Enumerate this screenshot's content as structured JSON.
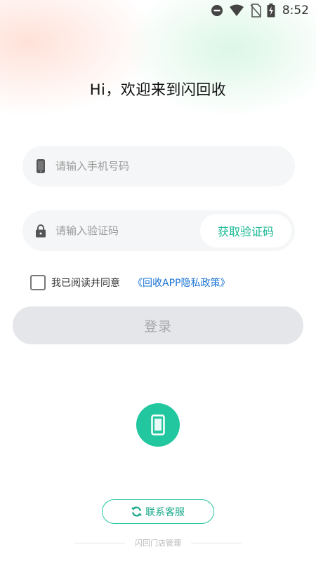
{
  "status_bar": {
    "time": "8:52",
    "icons": [
      "do-not-disturb-icon",
      "wifi-icon",
      "no-sim-icon",
      "battery-charging-icon"
    ]
  },
  "welcome_text": "Hi，欢迎来到闪回收",
  "phone_field": {
    "placeholder": "请输入手机号码",
    "value": "",
    "icon": "phone-icon"
  },
  "code_field": {
    "placeholder": "请输入验证码",
    "value": "",
    "icon": "lock-icon",
    "get_code_label": "获取验证码"
  },
  "agreement": {
    "checked": false,
    "text": "我已阅读并同意",
    "link_text": "《回收APP隐私政策》"
  },
  "login_button": {
    "label": "登录",
    "enabled": false
  },
  "alt_login": {
    "icon": "phone-icon"
  },
  "contact_button": {
    "label": "联系客服",
    "icon": "customer-service-icon"
  },
  "footer": {
    "text": "闪回门店管理"
  },
  "colors": {
    "accent": "#23c79f",
    "link": "#1a74d6",
    "field_bg": "#f5f6f7",
    "login_disabled_bg": "#e4e6e9"
  }
}
